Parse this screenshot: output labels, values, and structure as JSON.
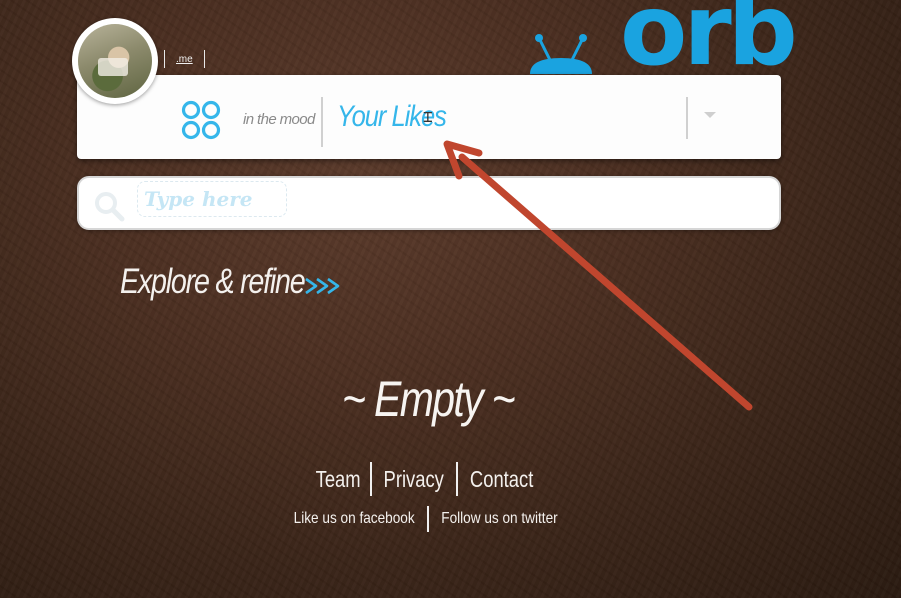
{
  "user": {
    "me_link": ".me"
  },
  "brand": {
    "logo_text": "orb",
    "logo_color": "#1aa3e0"
  },
  "mood": {
    "label": "in the mood",
    "value": "Your Likes",
    "icon": "four-circles-icon",
    "accent_color": "#35b6ea"
  },
  "search": {
    "placeholder": "Type here",
    "value": ""
  },
  "explore": {
    "label": "Explore & refine",
    "icon": "triple-chevron-right-icon"
  },
  "content": {
    "empty_text": "~ Empty ~"
  },
  "footer": {
    "links": [
      "Team",
      "Privacy",
      "Contact"
    ],
    "social": [
      "Like us on facebook",
      "Follow us on twitter"
    ]
  },
  "annotation": {
    "color": "#c0462e"
  }
}
